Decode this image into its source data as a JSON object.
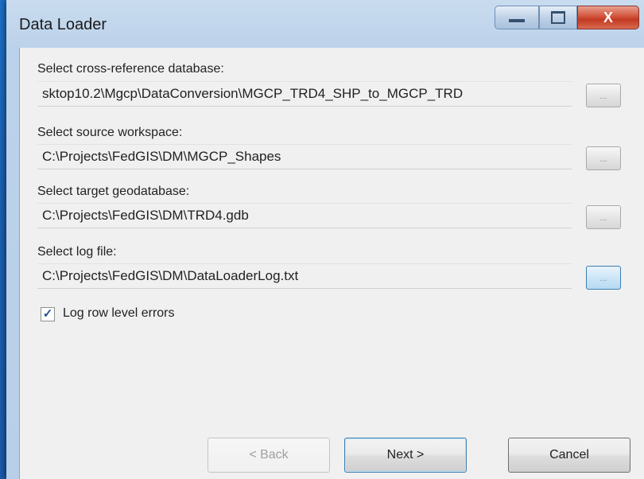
{
  "window": {
    "title": "Data Loader",
    "controls": {
      "minimize": "minimize",
      "maximize": "maximize",
      "close": "X"
    }
  },
  "fields": [
    {
      "label": "Select cross-reference database:",
      "value": "sktop10.2\\Mgcp\\DataConversion\\MGCP_TRD4_SHP_to_MGCP_TRD",
      "browse": "..."
    },
    {
      "label": "Select source workspace:",
      "value": "C:\\Projects\\FedGIS\\DM\\MGCP_Shapes",
      "browse": "..."
    },
    {
      "label": "Select target geodatabase:",
      "value": "C:\\Projects\\FedGIS\\DM\\TRD4.gdb",
      "browse": "..."
    },
    {
      "label": "Select log file:",
      "value": "C:\\Projects\\FedGIS\\DM\\DataLoaderLog.txt",
      "browse": "..."
    }
  ],
  "options": {
    "log_row_errors": {
      "label": "Log row level errors",
      "checked": true,
      "mark": "✓"
    }
  },
  "buttons": {
    "back": "< Back",
    "next": "Next >",
    "cancel": "Cancel"
  }
}
